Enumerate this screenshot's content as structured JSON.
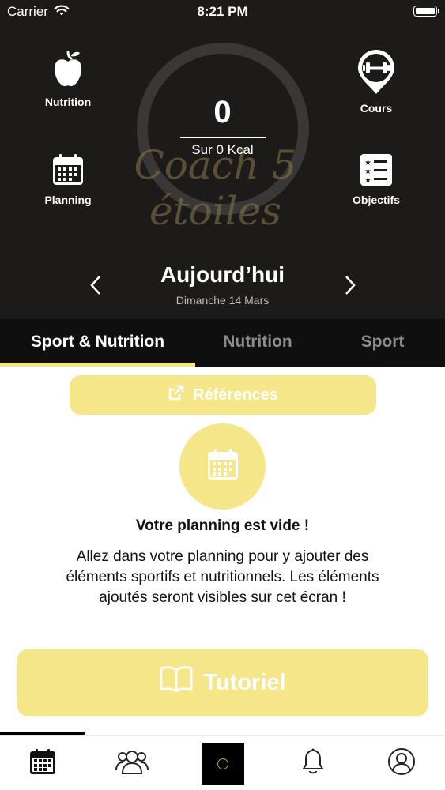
{
  "status_bar": {
    "carrier": "Carrier",
    "time": "8:21 PM"
  },
  "summary": {
    "kcal_value": "0",
    "kcal_label": "Sur 0 Kcal",
    "watermark": "Coach 5 étoiles"
  },
  "shortcuts": {
    "nutrition": {
      "label": "Nutrition",
      "icon": "apple-icon"
    },
    "cours": {
      "label": "Cours",
      "icon": "dumbbell-pin-icon"
    },
    "planning": {
      "label": "Planning",
      "icon": "calendar-icon"
    },
    "objectifs": {
      "label": "Objectifs",
      "icon": "checklist-icon"
    }
  },
  "date_nav": {
    "title": "Aujourd’hui",
    "subtitle": "Dimanche 14 Mars"
  },
  "tabs": [
    {
      "label": "Sport & Nutrition",
      "active": true
    },
    {
      "label": "Nutrition",
      "active": false
    },
    {
      "label": "Sport",
      "active": false
    }
  ],
  "content": {
    "references_label": "Références",
    "empty_title": "Votre planning est vide !",
    "empty_text": "Allez dans votre planning pour y ajouter des éléments sportifs et nutritionnels. Les éléments ajoutés seront visibles sur cet écran !",
    "tutorial_label": "Tutoriel"
  },
  "bottom_nav": [
    {
      "name": "planning",
      "icon": "calendar-icon"
    },
    {
      "name": "community",
      "icon": "group-icon"
    },
    {
      "name": "home",
      "icon": "coach-logo"
    },
    {
      "name": "notifications",
      "icon": "bell-icon"
    },
    {
      "name": "profile",
      "icon": "user-icon"
    }
  ],
  "colors": {
    "header_bg": "#1d1b1a",
    "accent_yellow": "#f6e68a",
    "tab_bar": "#0f0f0f"
  }
}
